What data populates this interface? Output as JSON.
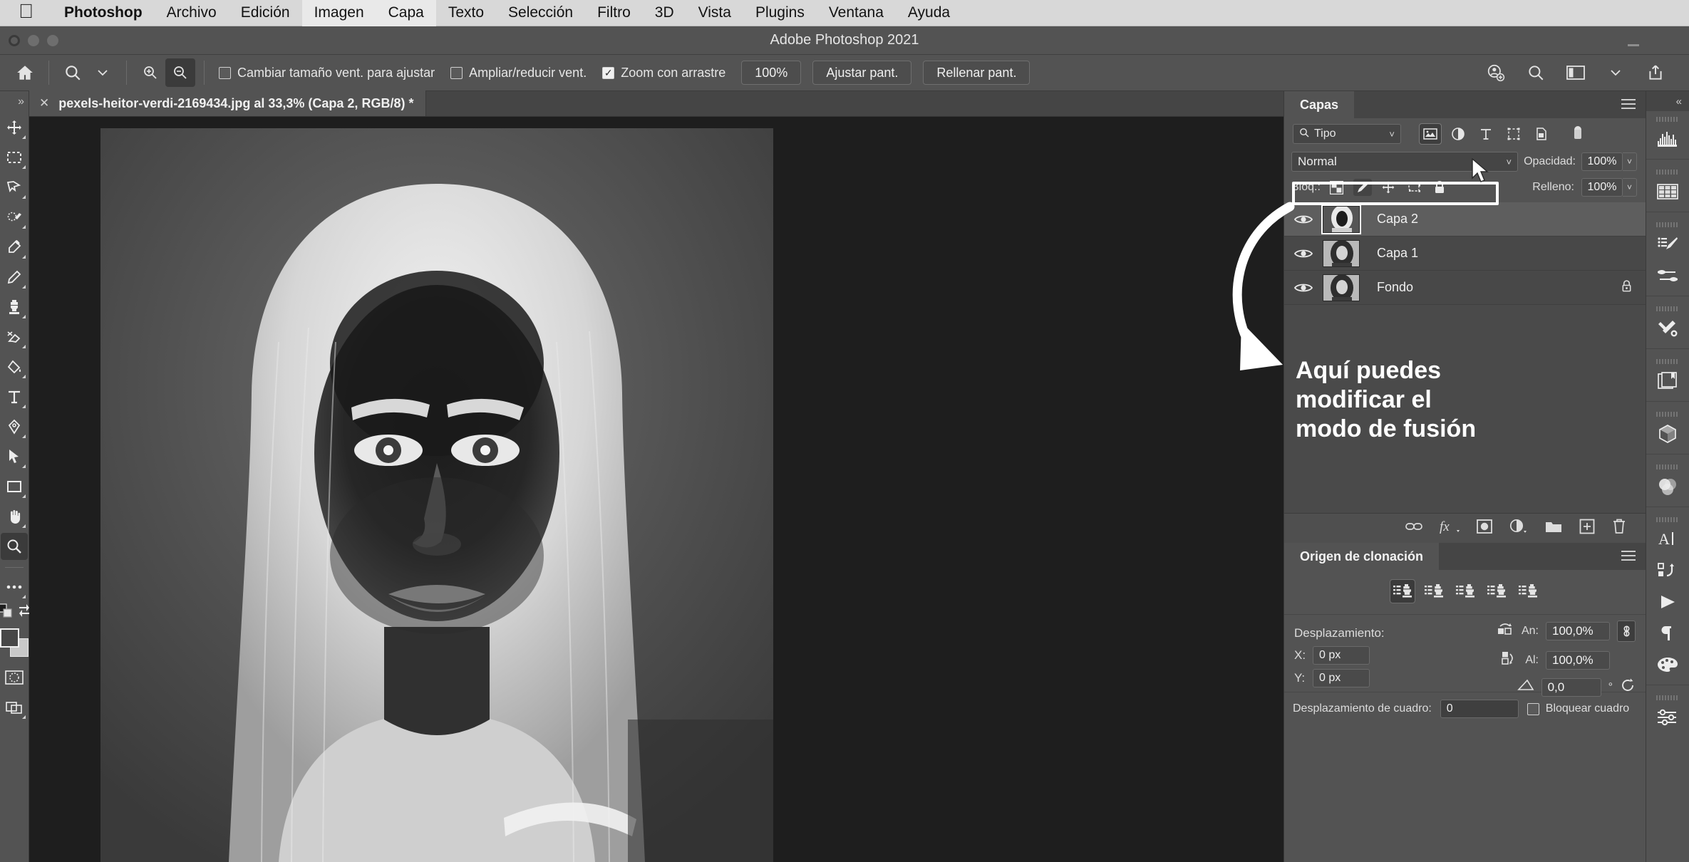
{
  "mac_menu": {
    "apple_icon": "apple-logo-icon",
    "items": [
      {
        "label": "Photoshop",
        "bold": true,
        "highlight": false
      },
      {
        "label": "Archivo",
        "bold": false,
        "highlight": false
      },
      {
        "label": "Edición",
        "bold": false,
        "highlight": false
      },
      {
        "label": "Imagen",
        "bold": false,
        "highlight": true
      },
      {
        "label": "Capa",
        "bold": false,
        "highlight": true
      },
      {
        "label": "Texto",
        "bold": false,
        "highlight": false
      },
      {
        "label": "Selección",
        "bold": false,
        "highlight": false
      },
      {
        "label": "Filtro",
        "bold": false,
        "highlight": false
      },
      {
        "label": "3D",
        "bold": false,
        "highlight": false
      },
      {
        "label": "Vista",
        "bold": false,
        "highlight": false
      },
      {
        "label": "Plugins",
        "bold": false,
        "highlight": false
      },
      {
        "label": "Ventana",
        "bold": false,
        "highlight": false
      },
      {
        "label": "Ayuda",
        "bold": false,
        "highlight": false
      }
    ]
  },
  "window": {
    "title": "Adobe Photoshop 2021"
  },
  "options_bar": {
    "home_icon": "home-icon",
    "tool_icon": "zoom-tool-icon",
    "tool_preset_chevron": "chevron-down-icon",
    "zoom_in_icon": "zoom-in-icon",
    "zoom_out_icon": "zoom-out-icon",
    "checkboxes": [
      {
        "label": "Cambiar tamaño vent. para ajustar",
        "checked": false
      },
      {
        "label": "Ampliar/reducir vent.",
        "checked": false
      },
      {
        "label": "Zoom con arrastre",
        "checked": true
      }
    ],
    "buttons": [
      {
        "label": "100%"
      },
      {
        "label": "Ajustar pant."
      },
      {
        "label": "Rellenar pant."
      }
    ],
    "right_icons": [
      "share-user-icon",
      "search-icon",
      "workspace-icon",
      "chevron-down-icon",
      "share-export-icon"
    ]
  },
  "left_toolbar": {
    "collapse_icon": "expand-chevrons-icon",
    "tools": [
      {
        "name": "move-tool",
        "glyph": "move"
      },
      {
        "name": "rectangular-marquee-tool",
        "glyph": "marquee"
      },
      {
        "name": "lasso-tool",
        "glyph": "lasso"
      },
      {
        "name": "quick-selection-tool",
        "glyph": "quickselect"
      },
      {
        "name": "eyedropper-tool",
        "glyph": "eyedropper"
      },
      {
        "name": "pencil-tool",
        "glyph": "pencil"
      },
      {
        "name": "clone-stamp-tool",
        "glyph": "stamp"
      },
      {
        "name": "eraser-tool",
        "glyph": "eraser"
      },
      {
        "name": "paint-bucket-tool",
        "glyph": "bucket"
      },
      {
        "name": "type-tool",
        "glyph": "type"
      },
      {
        "name": "pen-tool",
        "glyph": "pen"
      },
      {
        "name": "path-selection-tool",
        "glyph": "arrow"
      },
      {
        "name": "rectangle-tool",
        "glyph": "rect"
      },
      {
        "name": "hand-tool",
        "glyph": "hand"
      },
      {
        "name": "zoom-tool",
        "glyph": "zoom",
        "active": true
      },
      {
        "name": "edit-toolbar-tool",
        "glyph": "dots"
      }
    ],
    "foreground_color": "#474747",
    "background_color": "#c8c8c8",
    "quickmask_icon": "quick-mask-icon",
    "screenmode_icon": "screen-mode-icon",
    "swap_icon": "swap-colors-icon",
    "default_colors_icon": "default-colors-icon"
  },
  "document": {
    "close_icon": "close-icon",
    "tab_title": "pexels-heitor-verdi-2169434.jpg al 33,3% (Capa 2, RGB/8) *"
  },
  "layers_panel": {
    "tab_label": "Capas",
    "menu_icon": "panel-menu-icon",
    "filter": {
      "search_icon": "search-icon",
      "value": "Tipo",
      "chevron": "chevron-down-icon",
      "type_filters": [
        "pixel-layers-icon",
        "adjustment-layers-icon",
        "type-layers-icon",
        "shape-layers-icon",
        "smart-object-icon"
      ],
      "toggle_icon": "filter-toggle-icon"
    },
    "blend_mode": {
      "label": "",
      "value": "Normal",
      "chevron": "chevron-down-icon",
      "highlighted": true
    },
    "opacity": {
      "label": "Opacidad:",
      "value": "100%"
    },
    "lock": {
      "label": "Bloq.:",
      "icons": [
        "lock-transparent-pixels-icon",
        "lock-image-pixels-icon",
        "lock-position-icon",
        "lock-artboard-icon",
        "lock-all-icon"
      ]
    },
    "fill": {
      "label": "Relleno:",
      "value": "100%"
    },
    "layers": [
      {
        "name": "Capa 2",
        "visible": true,
        "selected": true,
        "locked": false
      },
      {
        "name": "Capa 1",
        "visible": true,
        "selected": false,
        "locked": false
      },
      {
        "name": "Fondo",
        "visible": true,
        "selected": false,
        "locked": true
      }
    ],
    "footer_icons": [
      "link-layers-icon",
      "layer-style-fx-icon",
      "add-mask-icon",
      "adjustment-layer-icon",
      "new-group-icon",
      "new-layer-icon",
      "delete-layer-icon"
    ]
  },
  "clone_panel": {
    "tab_label": "Origen de clonación",
    "menu_icon": "panel-menu-icon",
    "sources": [
      {
        "name": "clone-source-1",
        "active": true
      },
      {
        "name": "clone-source-2",
        "active": false
      },
      {
        "name": "clone-source-3",
        "active": false
      },
      {
        "name": "clone-source-4",
        "active": false
      },
      {
        "name": "clone-source-5",
        "active": false
      }
    ],
    "offset_label": "Desplazamiento:",
    "x": {
      "label": "X:",
      "value": "0 px"
    },
    "y": {
      "label": "Y:",
      "value": "0 px"
    },
    "width": {
      "label": "An:",
      "value": "100,0%",
      "icon": "flip-horizontal-icon"
    },
    "height": {
      "label": "Al:",
      "value": "100,0%",
      "icon": "flip-vertical-icon"
    },
    "angle": {
      "value": "0,0",
      "unit": "°",
      "icon": "angle-icon",
      "reset_icon": "reset-transform-icon"
    },
    "link_icon": "link-dimensions-icon",
    "frame_offset": {
      "label": "Desplazamiento de cuadro:",
      "value": "0"
    },
    "lock_frame": {
      "label": "Bloquear cuadro",
      "checked": false
    }
  },
  "right_rail": {
    "collapse_icon": "collapse-panels-icon",
    "icons": [
      "histogram-icon",
      "swatches-grid-icon",
      "brush-settings-icon",
      "brushes-icon",
      "tool-presets-icon",
      "libraries-icon",
      "3d-cube-icon",
      "adjustments-color-icon",
      "character-icon",
      "glyphs-icon",
      "timeline-play-icon",
      "paragraph-icon",
      "color-palette-icon",
      "properties-sliders-icon"
    ]
  },
  "annotation": {
    "text_line_1": "Aquí puedes",
    "text_line_2": "modificar el",
    "text_line_3": "modo de fusión",
    "arrow_color": "#ffffff",
    "highlight_color": "#ffffff",
    "cursor_icon": "mouse-cursor-icon"
  }
}
